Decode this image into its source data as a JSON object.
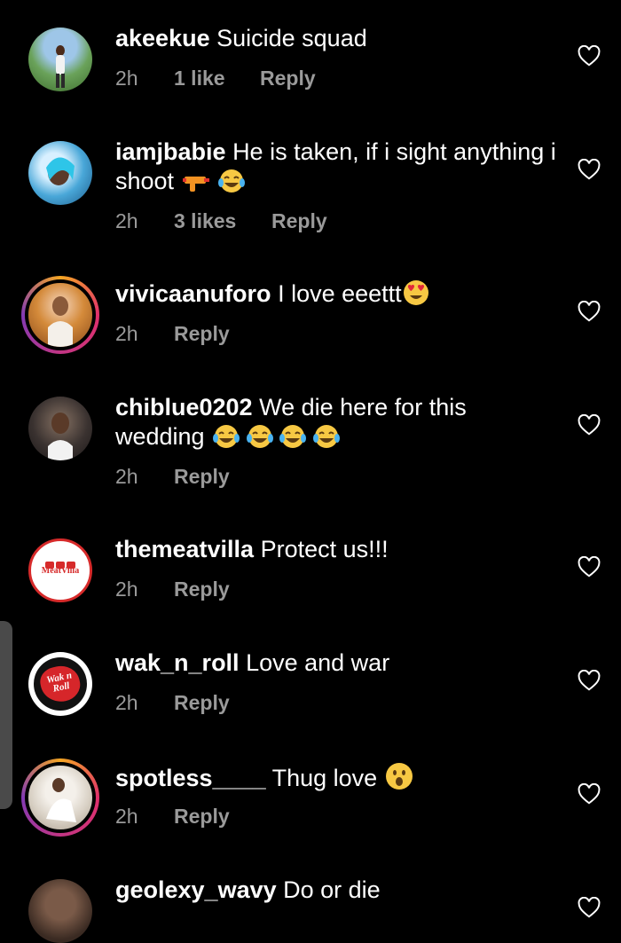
{
  "comments": [
    {
      "username": "akeekue",
      "text": "Suicide squad",
      "time": "2h",
      "likes": "1 like",
      "reply": "Reply"
    },
    {
      "username": "iamjbabie",
      "text": "He is taken, if i sight anything i shoot",
      "time": "2h",
      "likes": "3 likes",
      "reply": "Reply"
    },
    {
      "username": "vivicaanuforo",
      "text": "I love eeettt",
      "time": "2h",
      "reply": "Reply"
    },
    {
      "username": "chiblue0202",
      "text": "We die here for this wedding",
      "time": "2h",
      "reply": "Reply"
    },
    {
      "username": "themeatvilla",
      "text": "Protect us!!!",
      "time": "2h",
      "reply": "Reply",
      "avatar_text": "MeatVilla"
    },
    {
      "username": "wak_n_roll",
      "text": "Love and war",
      "time": "2h",
      "reply": "Reply",
      "avatar_text": "Wak n Roll"
    },
    {
      "username": "spotless____",
      "text": "Thug love",
      "time": "2h",
      "reply": "Reply"
    },
    {
      "username": "geolexy_wavy",
      "text": "Do or die"
    }
  ]
}
